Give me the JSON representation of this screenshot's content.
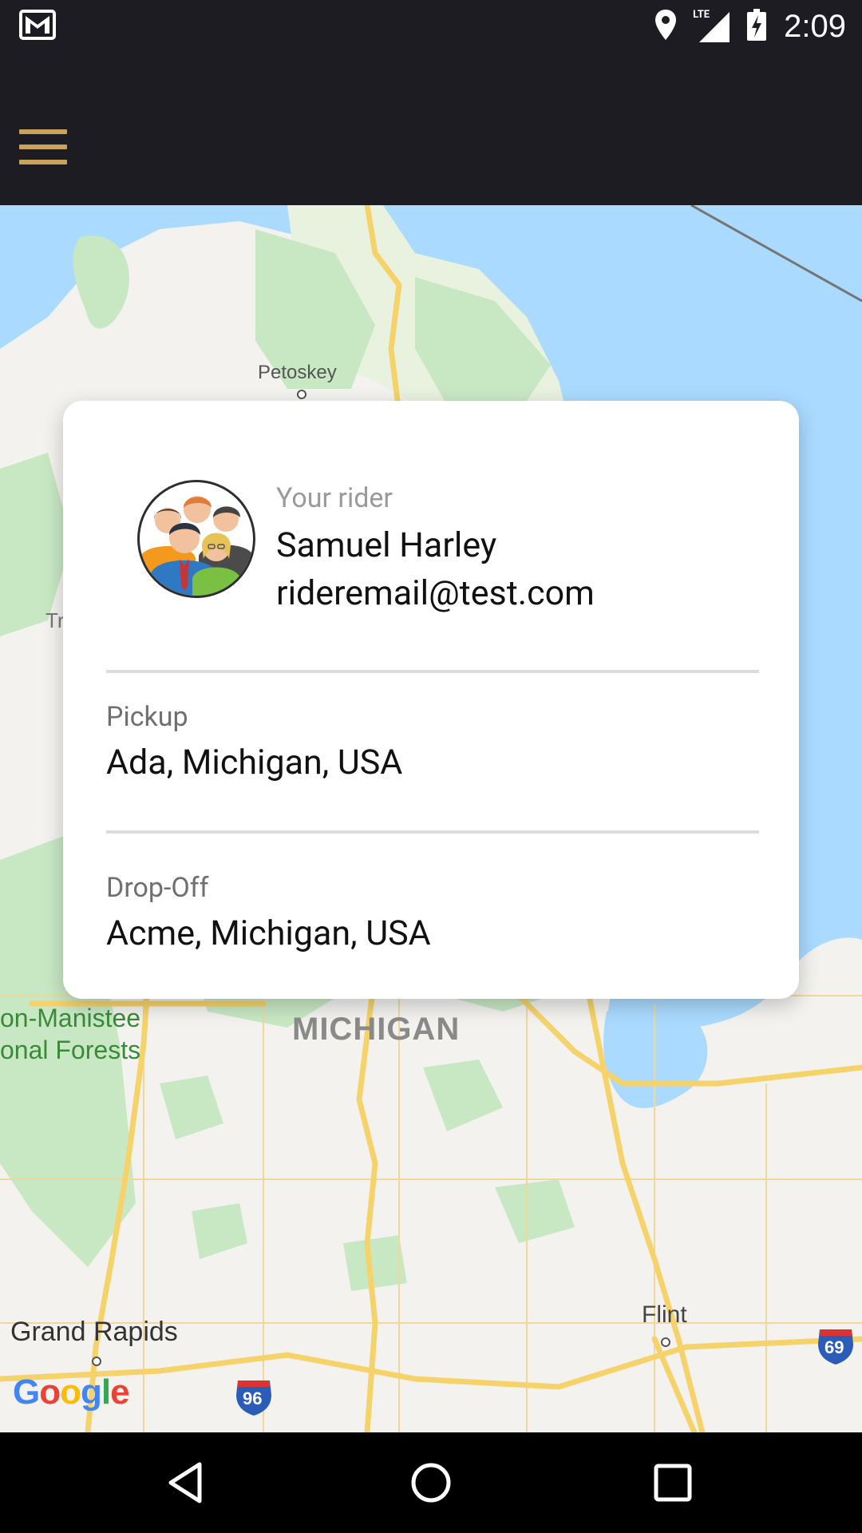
{
  "status_bar": {
    "time": "2:09",
    "network": "LTE",
    "icons": [
      "gmail-notification-icon",
      "location-icon",
      "lte-signal-icon",
      "battery-charging-icon"
    ]
  },
  "app_bar": {
    "menu_icon": "hamburger-menu-icon"
  },
  "map": {
    "labels": {
      "petoskey": "Petoskey",
      "traverse_partial": "Tr",
      "forest_line1": "on-Manistee",
      "forest_line2": "onal Forests",
      "state": "MICHIGAN",
      "grand_rapids": "Grand Rapids",
      "flint": "Flint",
      "i96": "96",
      "i69": "69"
    },
    "attribution": [
      "G",
      "o",
      "o",
      "g",
      "l",
      "e"
    ]
  },
  "rider_card": {
    "caption": "Your rider",
    "name": "Samuel Harley",
    "email": "rideremail@test.com",
    "pickup_label": "Pickup",
    "pickup_value": "Ada, Michigan, USA",
    "dropoff_label": "Drop-Off",
    "dropoff_value": "Acme, Michigan, USA"
  },
  "nav_bar": {
    "buttons": [
      "back-icon",
      "home-icon",
      "recents-icon"
    ]
  },
  "colors": {
    "bar_background": "#1c1c22",
    "menu_accent": "#c9a35a",
    "water": "#aadaff",
    "forest": "#c8e8c4",
    "land": "#f3f2ef",
    "road": "#f6d36a"
  }
}
